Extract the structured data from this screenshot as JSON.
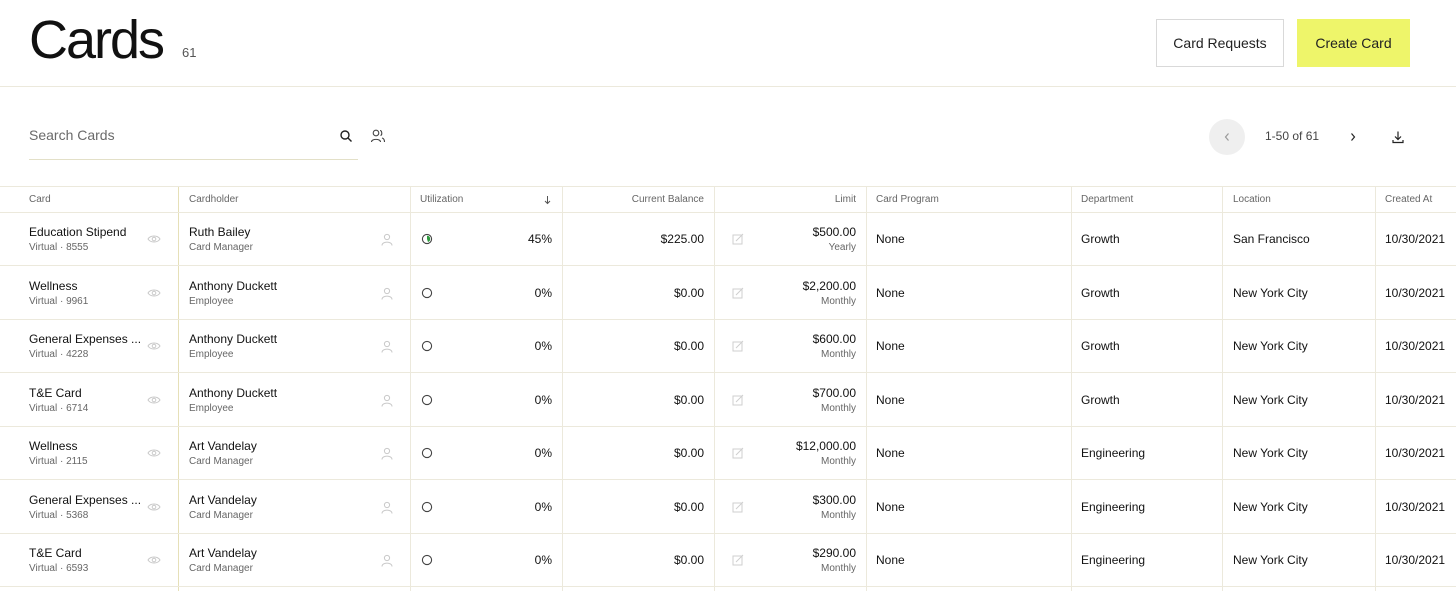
{
  "header": {
    "title": "Cards",
    "count": "61",
    "card_requests_label": "Card Requests",
    "create_card_label": "Create Card"
  },
  "toolbar": {
    "search_placeholder": "Search Cards",
    "page_info": "1-50 of 61"
  },
  "colors": {
    "accent": "#eef56a",
    "utilization_fill": "#2e9a3e",
    "border": "#ece9dc"
  },
  "icons": [
    "search-icon",
    "users-icon",
    "chevron-left-icon",
    "chevron-right-icon",
    "download-icon",
    "eye-icon",
    "person-icon",
    "utilization-ring-icon",
    "edit-icon",
    "sort-down-icon"
  ],
  "table": {
    "columns": [
      "Card",
      "Cardholder",
      "Utilization",
      "Current Balance",
      "Limit",
      "Card Program",
      "Department",
      "Location",
      "Created At"
    ],
    "rows": [
      {
        "card": "Education Stipend",
        "type": "Virtual",
        "last4": "8555",
        "holder": "Ruth Bailey",
        "role": "Card Manager",
        "utilization": "45%",
        "utilization_value": 0.45,
        "balance": "$225.00",
        "limit": "$500.00",
        "period": "Yearly",
        "program": "None",
        "department": "Growth",
        "location": "San Francisco",
        "created": "10/30/2021"
      },
      {
        "card": "Wellness",
        "type": "Virtual",
        "last4": "9961",
        "holder": "Anthony Duckett",
        "role": "Employee",
        "utilization": "0%",
        "utilization_value": 0,
        "balance": "$0.00",
        "limit": "$2,200.00",
        "period": "Monthly",
        "program": "None",
        "department": "Growth",
        "location": "New York City",
        "created": "10/30/2021"
      },
      {
        "card": "General Expenses ...",
        "type": "Virtual",
        "last4": "4228",
        "holder": "Anthony Duckett",
        "role": "Employee",
        "utilization": "0%",
        "utilization_value": 0,
        "balance": "$0.00",
        "limit": "$600.00",
        "period": "Monthly",
        "program": "None",
        "department": "Growth",
        "location": "New York City",
        "created": "10/30/2021"
      },
      {
        "card": "T&E Card",
        "type": "Virtual",
        "last4": "6714",
        "holder": "Anthony Duckett",
        "role": "Employee",
        "utilization": "0%",
        "utilization_value": 0,
        "balance": "$0.00",
        "limit": "$700.00",
        "period": "Monthly",
        "program": "None",
        "department": "Growth",
        "location": "New York City",
        "created": "10/30/2021"
      },
      {
        "card": "Wellness",
        "type": "Virtual",
        "last4": "2115",
        "holder": "Art Vandelay",
        "role": "Card Manager",
        "utilization": "0%",
        "utilization_value": 0,
        "balance": "$0.00",
        "limit": "$12,000.00",
        "period": "Monthly",
        "program": "None",
        "department": "Engineering",
        "location": "New York City",
        "created": "10/30/2021"
      },
      {
        "card": "General Expenses ...",
        "type": "Virtual",
        "last4": "5368",
        "holder": "Art Vandelay",
        "role": "Card Manager",
        "utilization": "0%",
        "utilization_value": 0,
        "balance": "$0.00",
        "limit": "$300.00",
        "period": "Monthly",
        "program": "None",
        "department": "Engineering",
        "location": "New York City",
        "created": "10/30/2021"
      },
      {
        "card": "T&E Card",
        "type": "Virtual",
        "last4": "6593",
        "holder": "Art Vandelay",
        "role": "Card Manager",
        "utilization": "0%",
        "utilization_value": 0,
        "balance": "$0.00",
        "limit": "$290.00",
        "period": "Monthly",
        "program": "None",
        "department": "Engineering",
        "location": "New York City",
        "created": "10/30/2021"
      }
    ]
  }
}
